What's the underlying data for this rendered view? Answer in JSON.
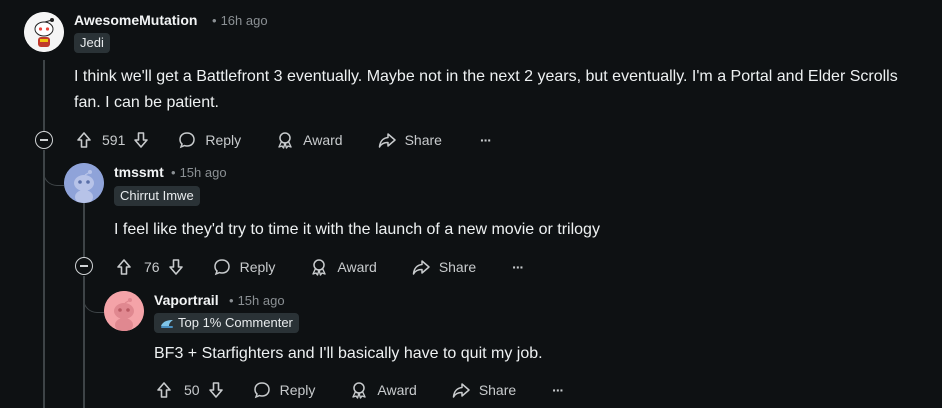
{
  "comments": [
    {
      "author": "AwesomeMutation",
      "time": "16h ago",
      "flair": "Jedi",
      "body": "I think we'll get a Battlefront 3 eventually. Maybe not in the next 2 years, but eventually. I'm a Portal and Elder Scrolls fan. I can be patient.",
      "score": "591"
    },
    {
      "author": "tmssmt",
      "time": "15h ago",
      "flair": "Chirrut Imwe",
      "body": "I feel like they'd try to time it with the launch of a new movie or trilogy",
      "score": "76"
    },
    {
      "author": "Vaportrail",
      "time": "15h ago",
      "flair": "Top 1% Commenter",
      "body": "BF3 + Starfighters and I'll basically have to quit my job.",
      "score": "50"
    }
  ],
  "actions": {
    "reply": "Reply",
    "award": "Award",
    "share": "Share",
    "more": "···"
  },
  "separator": "•",
  "colors": {
    "background": "#0e1113",
    "thread_line": "#3e4447",
    "flair_bg": "#2a3236",
    "avatar_blue": "#8fa3d9",
    "avatar_pink": "#f4a3a8"
  }
}
